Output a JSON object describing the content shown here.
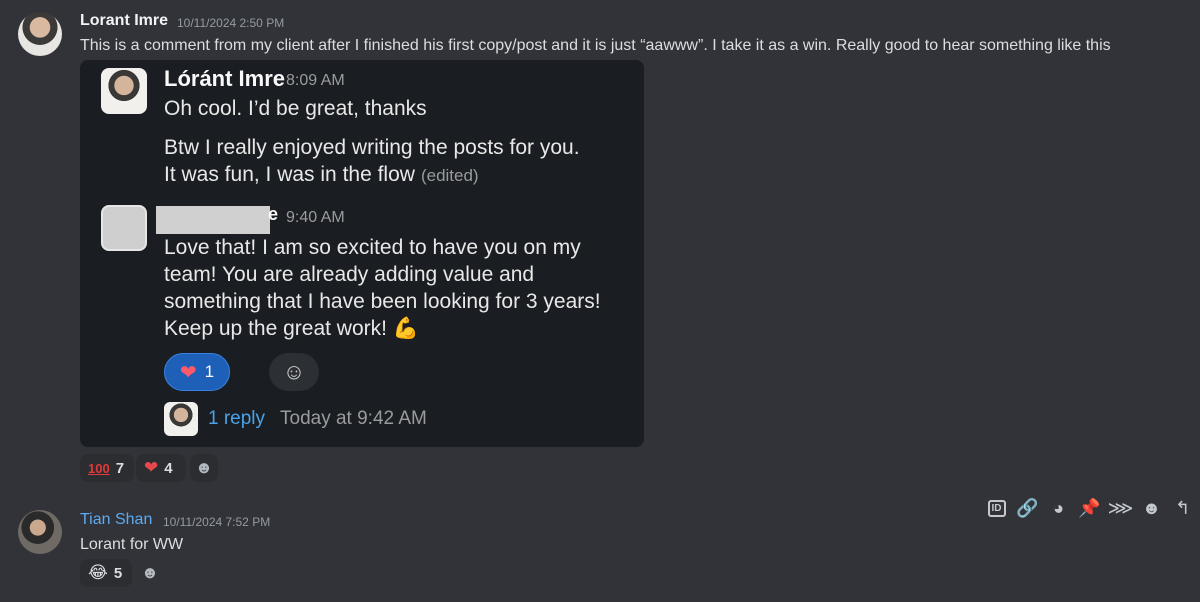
{
  "messages": [
    {
      "author": "Lorant Imre",
      "timestamp": "10/11/2024 2:50 PM",
      "text": "This is a comment from my client after I finished his first copy/post and it is just “aawww”. I take it as a win. Really good to hear something like this",
      "embedded_screenshot": {
        "msg1": {
          "author": "Lóránt Imre",
          "time": "8:09 AM",
          "line1": "Oh cool. I’d be great, thanks",
          "line2": "Btw I really enjoyed writing the posts for you.",
          "line3": "It was fun, I was in the flow",
          "edited": "(edited)"
        },
        "msg2": {
          "author_visible_suffix": "e",
          "time": "9:40 AM",
          "line1": "Love that! I am so excited to have you on my",
          "line2": "team! You are already adding value and",
          "line3": "something that I have been looking for 3 years!",
          "line4": "Keep up the great work!",
          "emoji": "💪",
          "reaction": {
            "emoji": "❤",
            "count": "1"
          },
          "reply_link": "1 reply",
          "reply_time": "Today at 9:42 AM"
        }
      },
      "reactions": [
        {
          "emoji": "💯",
          "label": "100",
          "count": "7"
        },
        {
          "emoji": "❤",
          "count": "4"
        }
      ]
    },
    {
      "author": "Tian Shan",
      "author_color": "#5ea9f0",
      "timestamp": "10/11/2024 7:52 PM",
      "text": "Lorant for WW",
      "reactions": [
        {
          "emoji": "😂",
          "count": "5"
        }
      ]
    }
  ],
  "toolbar_icons": [
    "copy-id-icon",
    "copy-link-icon",
    "reply-thread-icon",
    "pin-icon",
    "mark-unread-icon",
    "add-reaction-icon",
    "reply-icon"
  ],
  "toolbar": {
    "id_label": "ID"
  }
}
